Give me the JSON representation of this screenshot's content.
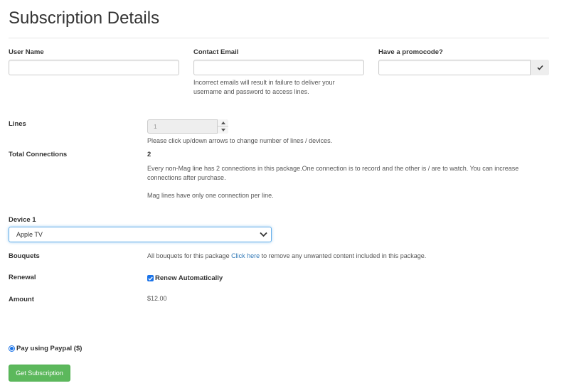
{
  "page": {
    "title": "Subscription Details"
  },
  "form": {
    "username": {
      "label": "User Name",
      "value": "",
      "placeholder": ""
    },
    "email": {
      "label": "Contact Email",
      "value": "",
      "placeholder": "",
      "help_line1": "Incorrect emails will result in failure to deliver your",
      "help_line2": "username and password to access lines."
    },
    "promo": {
      "label": "Have a promocode?",
      "value": "",
      "placeholder": "",
      "check_icon": "check-icon"
    },
    "lines": {
      "label": "Lines",
      "value": "1",
      "help": "Please click up/down arrows to change number of lines / devices."
    },
    "connections": {
      "label": "Total Connections",
      "value": "2",
      "note_line1": "Every non-Mag line has 2 connections in this package.One connection is to record and the other is / are to watch. You can increase",
      "note_line2": "connections after purchase.",
      "mag_note": "Mag lines have only one connection per line."
    },
    "device": {
      "label": "Device 1",
      "selected": "Apple TV"
    },
    "bouquets": {
      "label": "Bouquets",
      "text_before": "All bouquets for this package ",
      "link": "Click here",
      "text_after": " to remove any unwanted content included in this package."
    },
    "renewal": {
      "label": "Renewal",
      "checkbox_label": "Renew Automatically",
      "checked": true
    },
    "amount": {
      "label": "Amount",
      "value": "$12.00"
    },
    "payment": {
      "option_label": "Pay using Paypal ($)",
      "selected": true
    },
    "submit": {
      "label": "Get Subscription"
    }
  },
  "colors": {
    "accent": "#337ab7",
    "button": "#5cb85c",
    "focus": "#66afe9",
    "checkbox": "#1a73e8"
  }
}
